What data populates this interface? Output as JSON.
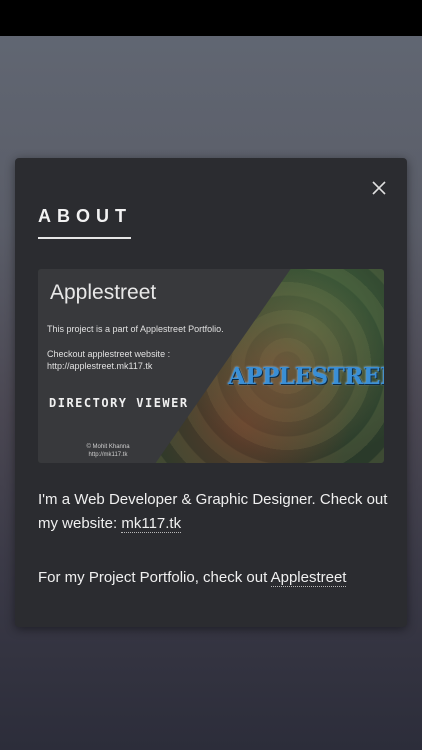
{
  "about": {
    "title": "ABOUT",
    "banner": {
      "title": "Applestreet",
      "line1": "This project is a part of Applestreet Portfolio.",
      "line2": "Checkout applestreet website :",
      "line3": "http://applestreet.mk117.tk",
      "directory_viewer": "DIRECTORY VIEWER",
      "credit_name": "© Mohit Khanna",
      "credit_url": "http://mk117.tk",
      "logo_text": "APPLESTREET",
      "logo_color": "#3a8fd6"
    },
    "para1_text": "I'm a Web Developer & Graphic Designer. Check out my website: ",
    "para1_link": "mk117.tk",
    "para2_text": "For my Project Portfolio, check out ",
    "para2_link": "Applestreet"
  },
  "icons": {
    "close": "close-icon"
  }
}
